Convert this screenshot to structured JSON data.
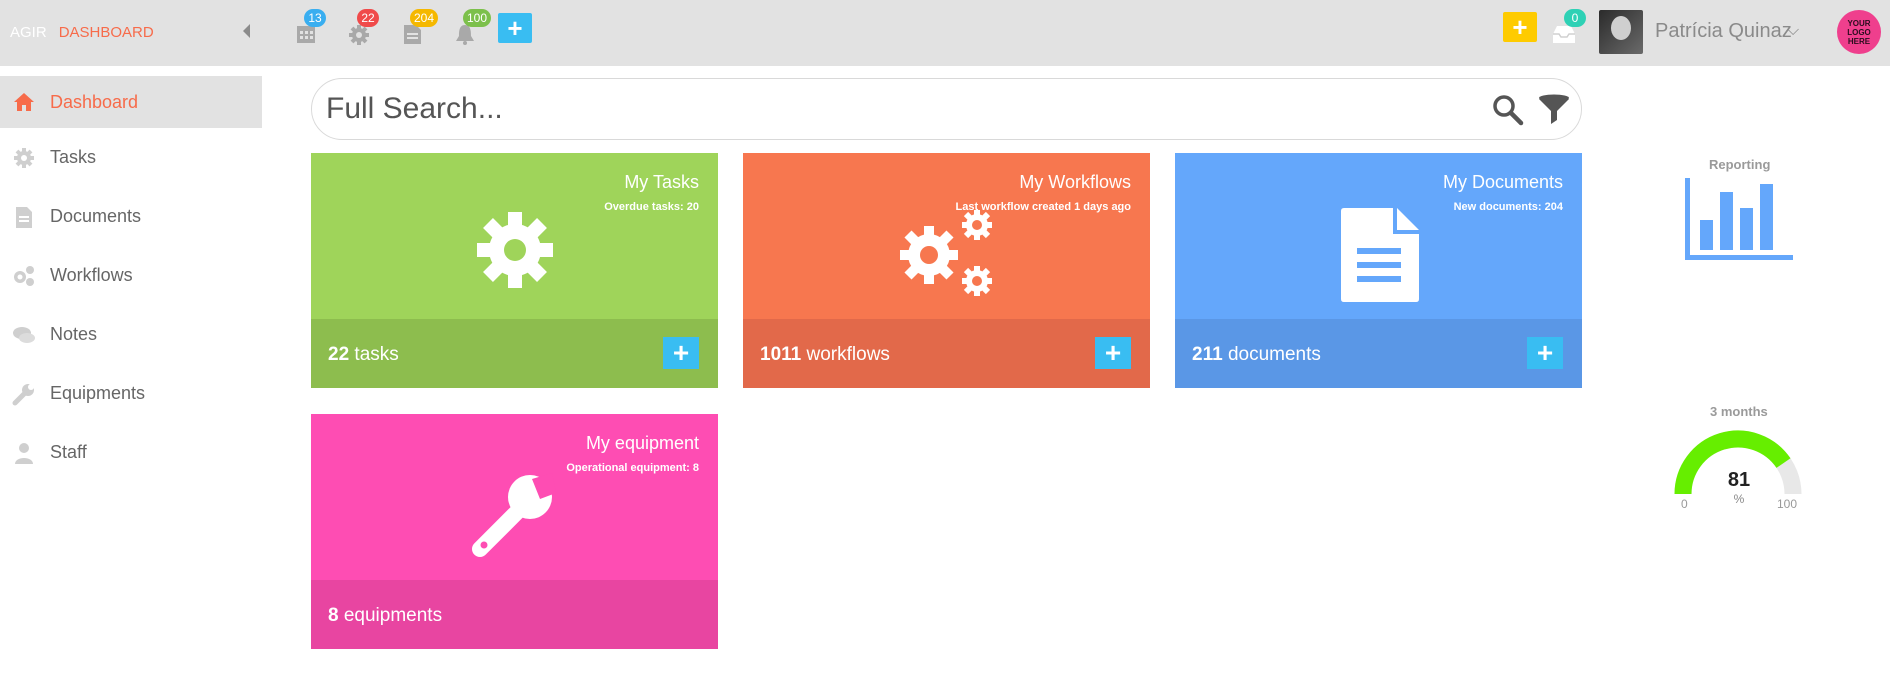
{
  "header": {
    "brand": "AGIR",
    "breadcrumb": "DASHBOARD",
    "badges": {
      "calendar": "13",
      "tasks": "22",
      "documents": "204",
      "notifications": "100",
      "inbox": "0"
    },
    "user_name": "Patrícia Quinaz",
    "logo_text": "YOUR LOGO HERE"
  },
  "sidebar": {
    "items": [
      {
        "label": "Dashboard",
        "icon": "home-icon"
      },
      {
        "label": "Tasks",
        "icon": "gear-icon"
      },
      {
        "label": "Documents",
        "icon": "document-icon"
      },
      {
        "label": "Workflows",
        "icon": "gears-icon"
      },
      {
        "label": "Notes",
        "icon": "comments-icon"
      },
      {
        "label": "Equipments",
        "icon": "wrench-icon"
      },
      {
        "label": "Staff",
        "icon": "user-icon"
      }
    ]
  },
  "search": {
    "placeholder": "Full Search..."
  },
  "cards": {
    "tasks": {
      "title": "My Tasks",
      "subtitle": "Overdue tasks: 20",
      "count": "22",
      "unit": "tasks",
      "color": "#9fd45a"
    },
    "workflows": {
      "title": "My Workflows",
      "subtitle": "Last workflow created 1 days ago",
      "count": "1011",
      "unit": "workflows",
      "color": "#f7774f"
    },
    "documents": {
      "title": "My Documents",
      "subtitle": "New documents: 204",
      "count": "211",
      "unit": "documents",
      "color": "#64a7fb"
    },
    "equipment": {
      "title": "My equipment",
      "subtitle": "Operational equipment: 8",
      "count": "8",
      "unit": "equipments",
      "color": "#fe4db3"
    }
  },
  "reporting": {
    "label": "Reporting"
  },
  "gauge": {
    "label": "3 months",
    "value": "81",
    "unit": "%",
    "min": "0",
    "max": "100"
  },
  "colors": {
    "accent": "#f76b4a",
    "add_button": "#39bdf2",
    "header_plus": "#fecb00",
    "gauge_fill": "#66ee00"
  }
}
